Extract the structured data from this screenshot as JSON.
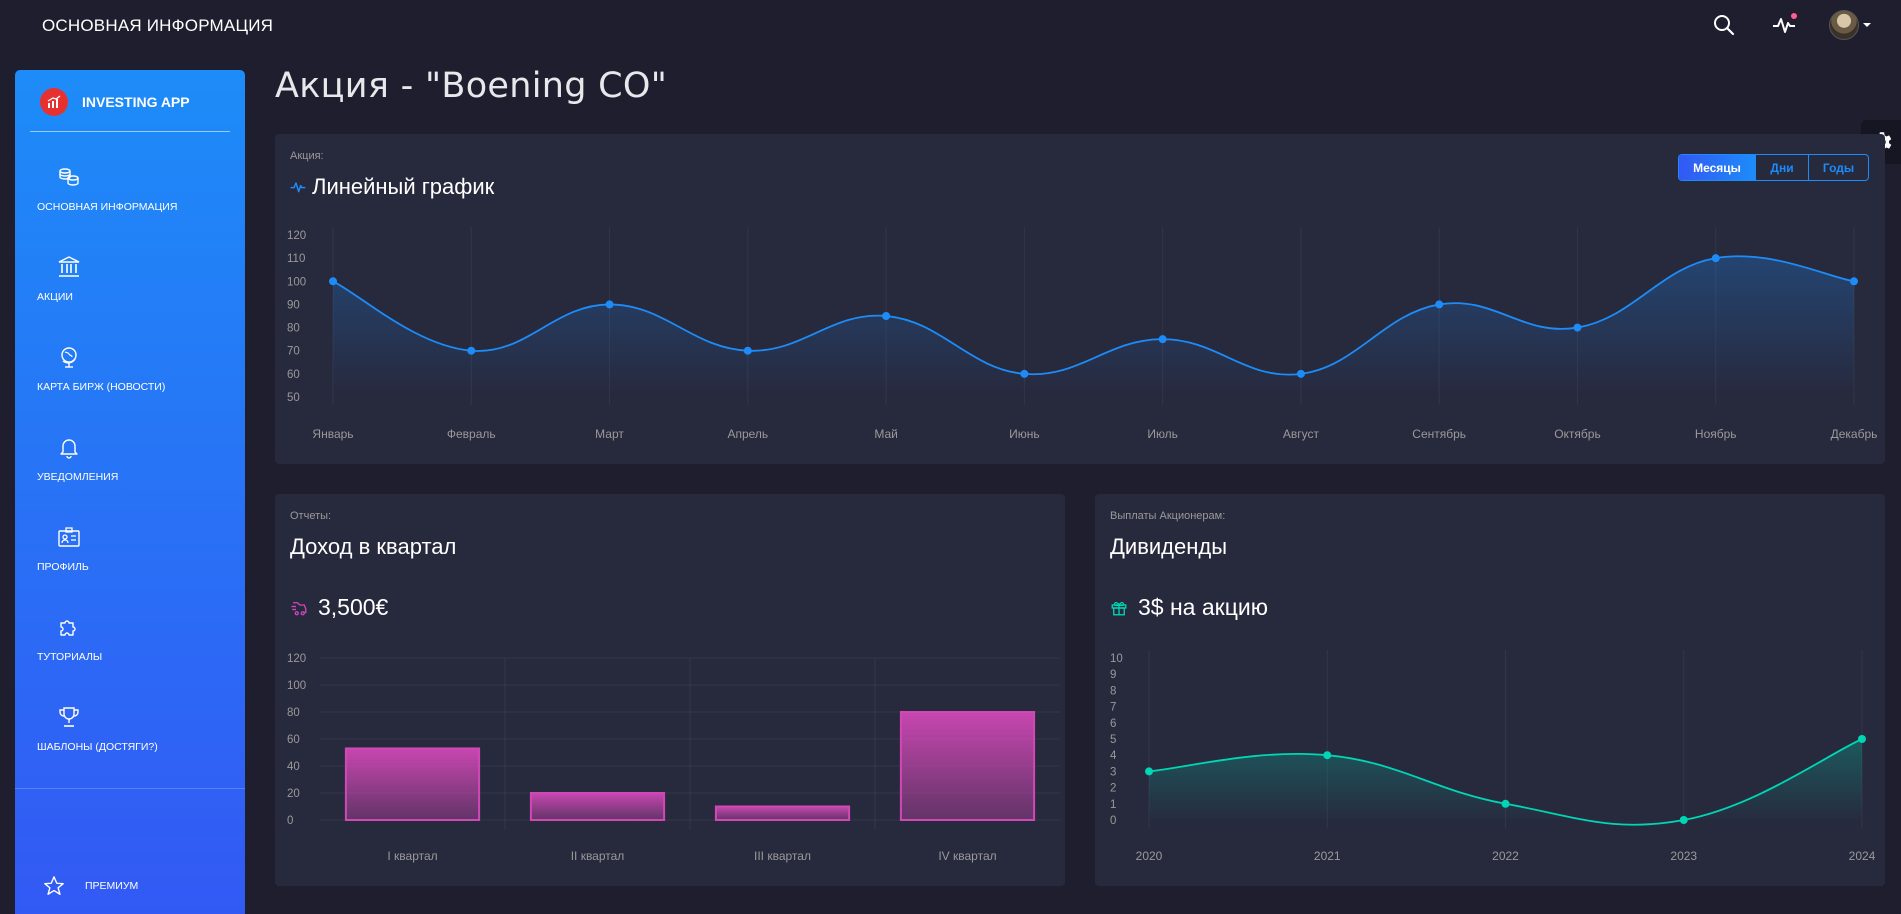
{
  "topbar": {
    "title": "ОСНОВНАЯ ИНФОРМАЦИЯ",
    "icons": [
      "search-icon",
      "pulse-icon",
      "avatar",
      "chevron-down-icon"
    ],
    "notification_color": "#fd5d93"
  },
  "sidebar": {
    "logo_text": "INVESTING APP",
    "items": [
      {
        "label": "ОСНОВНАЯ ИНФОРМАЦИЯ",
        "icon": "coins-icon"
      },
      {
        "label": "АКЦИИ",
        "icon": "bank-icon"
      },
      {
        "label": "КАРТА БИРЖ (НОВОСТИ)",
        "icon": "globe-icon"
      },
      {
        "label": "УВЕДОМЛЕНИЯ",
        "icon": "bell-icon"
      },
      {
        "label": "ПРОФИЛЬ",
        "icon": "id-card-icon"
      },
      {
        "label": "ТУТОРИАЛЫ",
        "icon": "puzzle-icon"
      },
      {
        "label": "ШАБЛОНЫ (ДОСТЯГИ?)",
        "icon": "trophy-icon"
      }
    ],
    "premium_label": "ПРЕМИУМ",
    "gradient": [
      "#1d8cf8",
      "#3358f4"
    ]
  },
  "page": {
    "title": "Акция - \"Boening CO\""
  },
  "stock_card": {
    "category": "Акция:",
    "title": "Линейный график",
    "tabs": [
      "Месяцы",
      "Дни",
      "Годы"
    ],
    "active_tab": "Месяцы"
  },
  "income_card": {
    "category": "Отчеты:",
    "title": "Доход в квартал",
    "value": "3,500€"
  },
  "dividends_card": {
    "category": "Выплаты Акционерам:",
    "title": "Дивиденды",
    "value": "3$ на акцию"
  },
  "chart_data": [
    {
      "type": "line",
      "categories": [
        "Январь",
        "Февраль",
        "Март",
        "Апрель",
        "Май",
        "Июнь",
        "Июль",
        "Август",
        "Сентябрь",
        "Октябрь",
        "Ноябрь",
        "Декабрь"
      ],
      "values": [
        100,
        70,
        90,
        70,
        85,
        60,
        75,
        60,
        90,
        80,
        110,
        100
      ],
      "yticks": [
        50,
        60,
        70,
        80,
        90,
        100,
        110,
        120
      ],
      "ylim": [
        50,
        120
      ],
      "color": "#1d8cf8",
      "grid": "vertical"
    },
    {
      "type": "bar",
      "categories": [
        "I квартал",
        "II квартал",
        "III квартал",
        "IV квартал"
      ],
      "values": [
        53,
        20,
        10,
        80
      ],
      "yticks": [
        0,
        20,
        40,
        60,
        80,
        100,
        120
      ],
      "ylim": [
        0,
        120
      ],
      "color": "#d048b6",
      "grid": "both"
    },
    {
      "type": "line",
      "categories": [
        "2020",
        "2021",
        "2022",
        "2023",
        "2024"
      ],
      "values": [
        3,
        4,
        1,
        0,
        5
      ],
      "yticks": [
        0,
        1,
        2,
        3,
        4,
        5,
        6,
        7,
        8,
        9,
        10
      ],
      "ylim": [
        0,
        10
      ],
      "color": "#00d6b4",
      "grid": "vertical"
    }
  ]
}
